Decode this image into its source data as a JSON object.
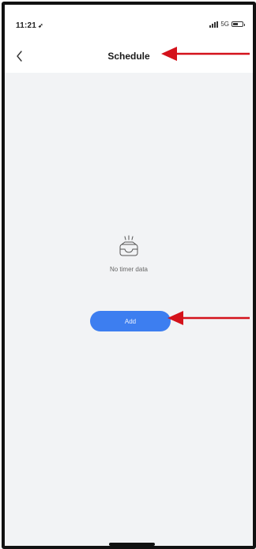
{
  "status_bar": {
    "time": "11:21",
    "network": "5G"
  },
  "header": {
    "title": "Schedule"
  },
  "empty_state": {
    "message": "No timer data"
  },
  "actions": {
    "add_label": "Add"
  },
  "colors": {
    "accent": "#3d7ef0",
    "annotation_arrow": "#d4121b",
    "background": "#f2f3f5"
  }
}
